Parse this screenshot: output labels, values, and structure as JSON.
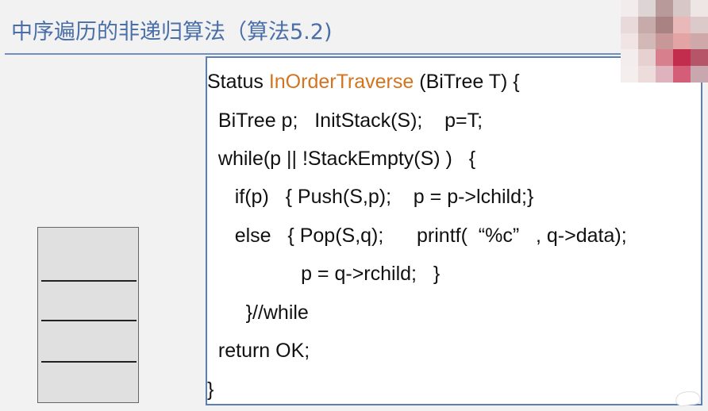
{
  "title": "中序遍历的非递归算法（算法5.2)",
  "code": {
    "line1_pre": "Status ",
    "line1_fn": "InOrderTraverse",
    "line1_post": " (BiTree T) {",
    "line2": "  BiTree p;   InitStack(S);    p=T;",
    "line3": "  while(p || !StackEmpty(S) )   {",
    "line4": "     if(p)   { Push(S,p);    p = p->lchild;}",
    "line5": "     else   { Pop(S,q);      printf(  “%c”   , q->data);",
    "line6": "                 p = q->rchild;   }",
    "line7": "       }//while",
    "line8": "  return OK;",
    "line9": "}"
  },
  "colors": {
    "title": "#4a6fa8",
    "function_name": "#d3741f",
    "border": "#5a7fb8"
  },
  "avatar_icon": "pixelated-avatar-icon",
  "corner_icon": "chat-bubble-icon"
}
